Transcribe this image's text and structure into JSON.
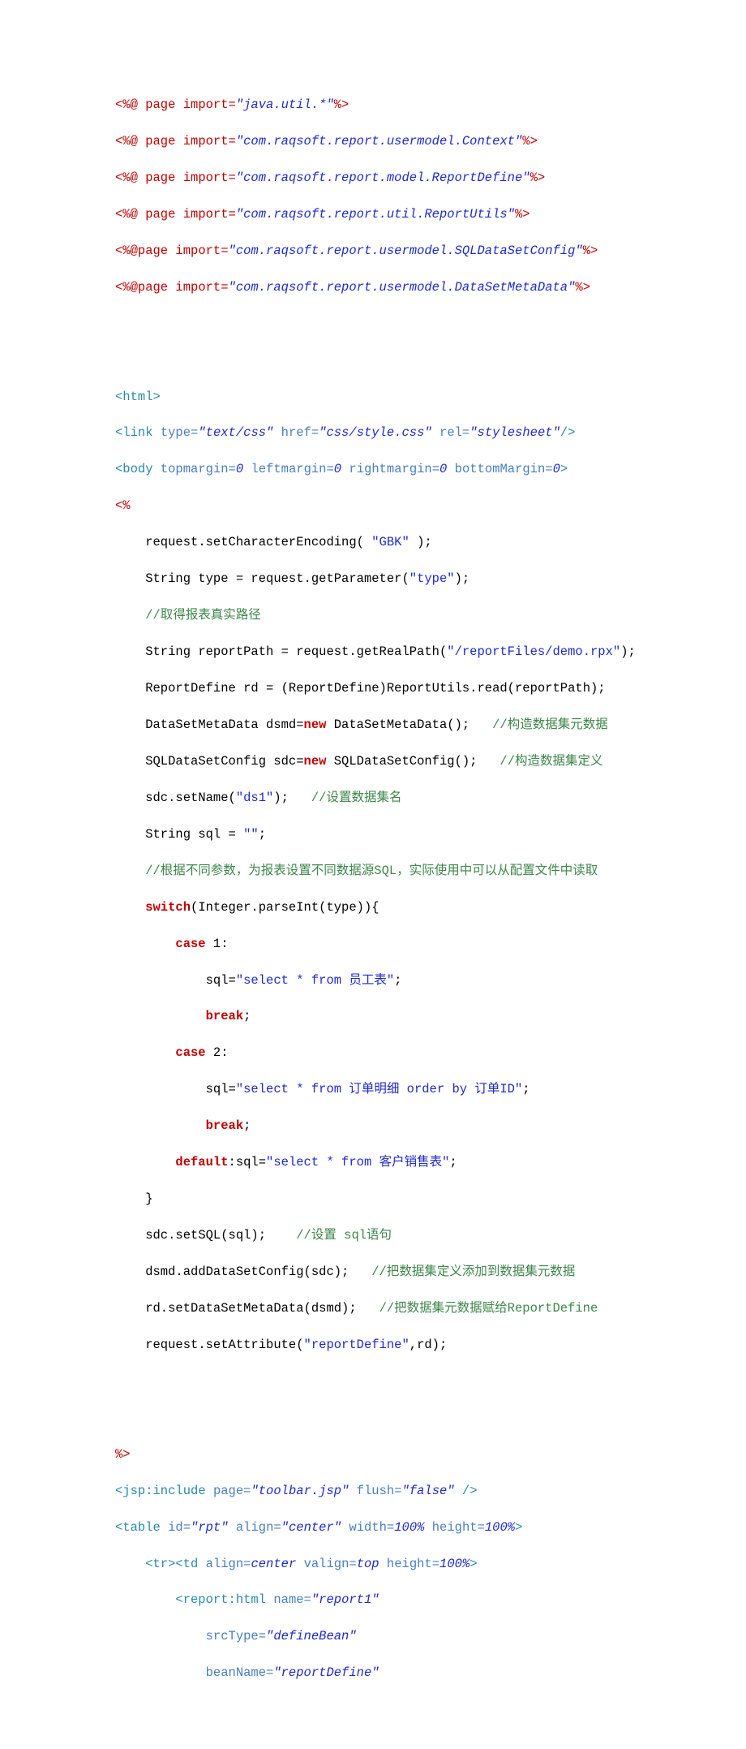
{
  "imports": [
    {
      "prefix": "<%@ page import=",
      "val": "\"java.util.*\"",
      "suffix": "%>"
    },
    {
      "prefix": "<%@ page import=",
      "val": "\"com.raqsoft.report.usermodel.Context\"",
      "suffix": "%>"
    },
    {
      "prefix": "<%@ page import=",
      "val": "\"com.raqsoft.report.model.ReportDefine\"",
      "suffix": "%>"
    },
    {
      "prefix": "<%@ page import=",
      "val": "\"com.raqsoft.report.util.ReportUtils\"",
      "suffix": "%>"
    },
    {
      "prefix": "<%@page import=",
      "val": "\"com.raqsoft.report.usermodel.SQLDataSetConfig\"",
      "suffix": "%>"
    },
    {
      "prefix": "<%@page import=",
      "val": "\"com.raqsoft.report.usermodel.DataSetMetaData\"",
      "suffix": "%>"
    }
  ],
  "tags": {
    "html_open": "<html>",
    "link_open": "<link",
    "type_attr": "type=",
    "type_val": "\"text/css\"",
    "href_attr": "href=",
    "href_val": "\"css/style.css\"",
    "rel_attr": "rel=",
    "rel_val": "\"stylesheet\"",
    "tag_close": "/>",
    "body_open": "<body",
    "topmargin": "topmargin=",
    "leftmargin": "leftmargin=",
    "rightmargin": "rightmargin=",
    "bottomMargin": "bottomMargin=",
    "zero": "0",
    "gt": ">",
    "scriptlet_open": "<%",
    "scriptlet_close": "%>"
  },
  "java": {
    "l1": "request.setCharacterEncoding( ",
    "s1": "\"GBK\"",
    "l1b": " );",
    "l2": "String type = request.getParameter(",
    "s2": "\"type\"",
    "l2b": ");",
    "c1": "//取得报表真实路径",
    "l3": "String reportPath = request.getRealPath(",
    "s3": "\"/reportFiles/demo.rpx\"",
    "l3b": ");",
    "l4": "ReportDefine rd = (ReportDefine)ReportUtils.read(reportPath);",
    "l5a": "DataSetMetaData dsmd=",
    "kw_new": "new",
    "l5b": " DataSetMetaData();   ",
    "c2": "//构造数据集元数据",
    "l6a": "SQLDataSetConfig sdc=",
    "l6b": " SQLDataSetConfig();   ",
    "c3": "//构造数据集定义",
    "l7a": "sdc.setName(",
    "s4": "\"ds1\"",
    "l7b": ");   ",
    "c4": "//设置数据集名",
    "l8a": "String sql = ",
    "s5": "\"\"",
    "l8b": ";",
    "c5": "//根据不同参数，为报表设置不同数据源SQL，实际使用中可以从配置文件中读取",
    "kw_switch": "switch",
    "l9a": "(Integer.parseInt(type)){",
    "kw_case": "case",
    "case1": " 1:",
    "l10a": "sql=",
    "s6": "\"select * from 员工表\"",
    "semi": ";",
    "kw_break": "break",
    "case2": " 2:",
    "s7": "\"select * from 订单明细 order by 订单ID\"",
    "kw_default": "default",
    "l11a": ":sql=",
    "s8": "\"select * from 客户销售表\"",
    "rbrace": "}",
    "l12a": "sdc.setSQL(sql);    ",
    "c6": "//设置 sql语句",
    "l13a": "dsmd.addDataSetConfig(sdc);   ",
    "c7": "//把数据集定义添加到数据集元数据",
    "l14a": "rd.setDataSetMetaData(dsmd);   ",
    "c8": "//把数据集元数据赋给ReportDefine",
    "l15a": "request.setAttribute(",
    "s9": "\"reportDefine\"",
    "l15b": ",rd);"
  },
  "bottom": {
    "jsp_inc_open": "<jsp:include",
    "page_attr": "page=",
    "page_val": "\"toolbar.jsp\"",
    "flush_attr": "flush=",
    "flush_val": "\"false\"",
    "jsp_inc_close": " />",
    "table_open": "<table",
    "id_attr": "id=",
    "id_val": "\"rpt\"",
    "align_attr": "align=",
    "align_val": "\"center\"",
    "width_attr": "width=",
    "pct": "100%",
    "height_attr": "height=",
    "tr_open": "<tr>",
    "td_open": "<td",
    "align2": "align=",
    "center2": "center",
    "valign": "valign=",
    "top": "top",
    "rpt_open": "<report:html",
    "name_attr": "name=",
    "name_val": "\"report1\"",
    "srcType_attr": "srcType=",
    "srcType_val": "\"defineBean\"",
    "beanName_attr": "beanName=",
    "beanName_val": "\"reportDefine\""
  }
}
